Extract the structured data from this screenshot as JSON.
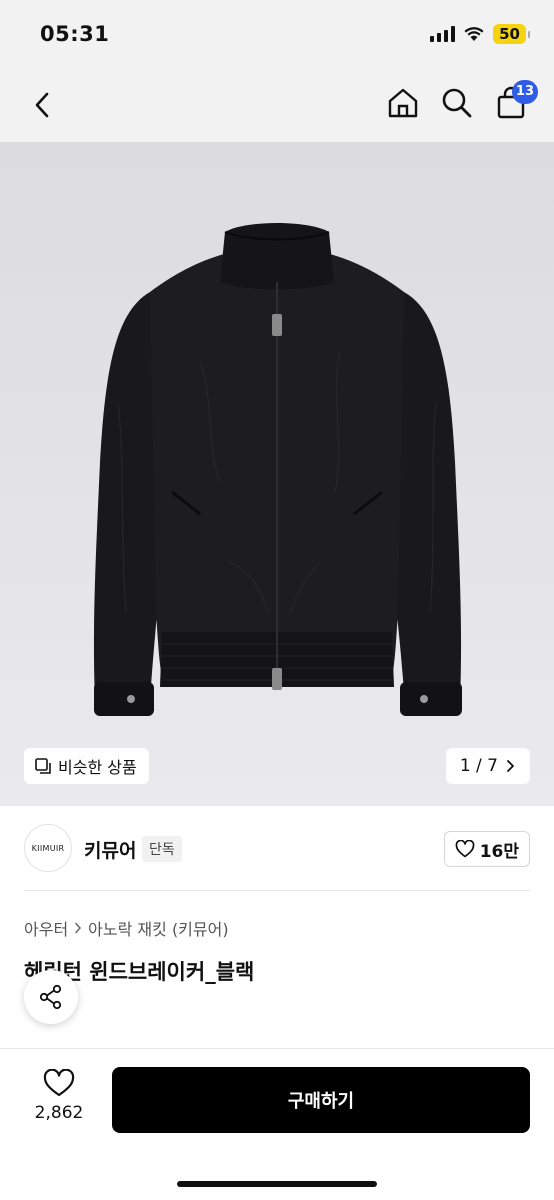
{
  "status": {
    "time": "05:31",
    "battery": "50"
  },
  "nav": {
    "cart_count": "13"
  },
  "gallery": {
    "similar_label": "비슷한 상품",
    "page": "1 / 7"
  },
  "brand": {
    "logo_text": "KIIMUIR",
    "name": "키뮤어",
    "badge": "단독",
    "likes": "16만"
  },
  "breadcrumb": {
    "items": [
      "아우터",
      "아노락 재킷 (키뮤어)"
    ]
  },
  "product": {
    "title": "헤링턴 윈드브레이커_블랙"
  },
  "bottom": {
    "wish_count": "2,862",
    "buy_label": "구매하기"
  },
  "colors": {
    "accent_badge": "#2f5de8",
    "buy_button": "#000000",
    "battery": "#f5d40f",
    "jacket": "#1a1a1c"
  }
}
